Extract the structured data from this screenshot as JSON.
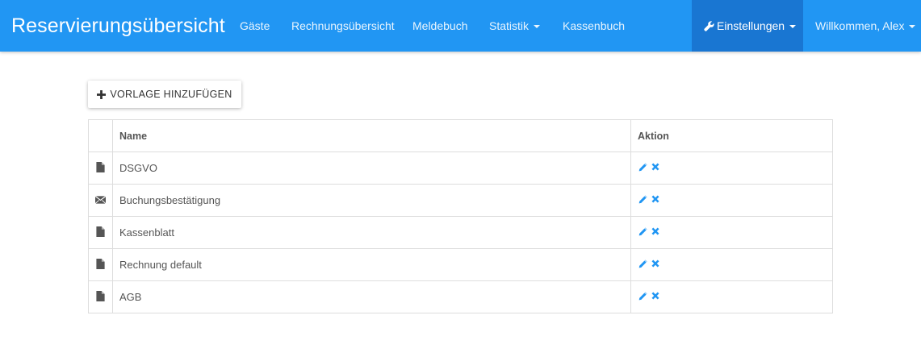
{
  "navbar": {
    "brand": "Reservierungsübersicht",
    "items": [
      {
        "label": "Gäste"
      },
      {
        "label": "Rechnungsübersicht"
      },
      {
        "label": "Meldebuch"
      },
      {
        "label": "Statistik"
      },
      {
        "label": "Kassenbuch"
      }
    ],
    "settings_label": "Einstellungen",
    "user_label": "Willkommen, Alex"
  },
  "toolbar": {
    "add_template_label": "VORLAGE HINZUFÜGEN"
  },
  "table": {
    "headers": {
      "name": "Name",
      "action": "Aktion"
    },
    "rows": [
      {
        "icon": "file-icon",
        "name": "DSGVO"
      },
      {
        "icon": "envelope-icon",
        "name": "Buchungsbestätigung"
      },
      {
        "icon": "file-icon",
        "name": "Kassenblatt"
      },
      {
        "icon": "file-icon",
        "name": "Rechnung default"
      },
      {
        "icon": "file-icon",
        "name": "AGB"
      }
    ]
  },
  "colors": {
    "navbar": "#2196f3",
    "navbar_active": "#1976d2",
    "action_icons": "#2196f3"
  }
}
